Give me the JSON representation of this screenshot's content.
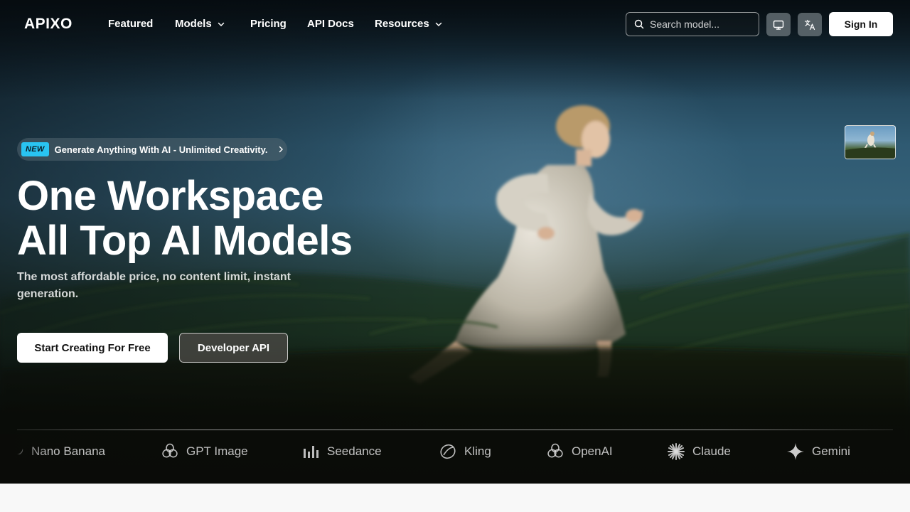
{
  "nav": {
    "logo": "APIXO",
    "items": [
      {
        "label": "Featured"
      },
      {
        "label": "Models"
      },
      {
        "label": "Pricing"
      },
      {
        "label": "API Docs"
      },
      {
        "label": "Resources"
      }
    ],
    "search_placeholder": "Search model...",
    "sign_in": "Sign In"
  },
  "hero": {
    "badge": "NEW",
    "announcement": "Generate Anything With AI - Unlimited Creativity.",
    "headline_line1": "One Workspace",
    "headline_line2": "All Top AI Models",
    "subtitle": "The most affordable price, no content limit, instant generation.",
    "cta_primary": "Start Creating For Free",
    "cta_secondary": "Developer API"
  },
  "models": [
    {
      "name": "Nano Banana",
      "icon": "banana-icon"
    },
    {
      "name": "GPT Image",
      "icon": "openai-icon"
    },
    {
      "name": "Seedance",
      "icon": "bars-icon"
    },
    {
      "name": "Kling",
      "icon": "kling-icon"
    },
    {
      "name": "OpenAI",
      "icon": "openai-icon"
    },
    {
      "name": "Claude",
      "icon": "claude-starburst-icon"
    },
    {
      "name": "Gemini",
      "icon": "gemini-sparkle-icon"
    }
  ],
  "colors": {
    "badge": "#29c4f2",
    "primary_button": "#ffffff",
    "bottom_band": "#f8f8f8"
  }
}
